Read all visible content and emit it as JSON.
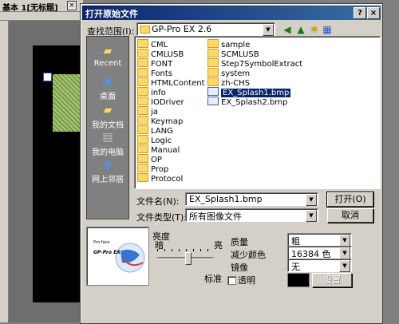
{
  "background_window": {
    "tab_title": "基本 1[无标题]",
    "tab_close": "×"
  },
  "dialog": {
    "title": "打开原始文件",
    "help_btn": "?",
    "close_btn": "×",
    "lookin_label": "查找范围(I):",
    "lookin_value": "GP-Pro EX 2.6",
    "places": [
      {
        "label": "Recent",
        "icon": "recent-folder-icon"
      },
      {
        "label": "桌面",
        "icon": "desktop-icon"
      },
      {
        "label": "我的文档",
        "icon": "my-documents-icon"
      },
      {
        "label": "我的电脑",
        "icon": "my-computer-icon"
      },
      {
        "label": "网上邻居",
        "icon": "network-icon"
      }
    ],
    "files_col1": [
      "CML",
      "CMLUSB",
      "FONT",
      "Fonts",
      "HTMLContent",
      "info",
      "IODriver",
      "ja",
      "Keymap",
      "LANG",
      "Logic",
      "Manual",
      "OP",
      "Prop",
      "Protocol"
    ],
    "files_col2": [
      {
        "name": "sample",
        "type": "folder"
      },
      {
        "name": "SCMLUSB",
        "type": "folder"
      },
      {
        "name": "Step7SymbolExtract",
        "type": "folder"
      },
      {
        "name": "system",
        "type": "folder"
      },
      {
        "name": "zh-CHS",
        "type": "folder"
      },
      {
        "name": "EX_Splash1.bmp",
        "type": "bmp",
        "selected": true
      },
      {
        "name": "EX_Splash2.bmp",
        "type": "bmp"
      }
    ],
    "filename_label": "文件名(N):",
    "filename_value": "EX_Splash1.bmp",
    "filetype_label": "文件类型(T):",
    "filetype_value": "所有图像文件",
    "open_btn": "打开(O)",
    "cancel_btn": "取消",
    "brightness_label": "亮度",
    "dark_label": "暗",
    "bright_label": "亮",
    "brightness_level": 0.55,
    "standard_label": "标准",
    "transparent_label": "透明",
    "quality_label": "质量",
    "quality_value": "粗",
    "reduce_color_label": "减少颜色",
    "reduce_color_value": "16384 色",
    "mirror_label": "镜像",
    "mirror_value": "无",
    "settings_btn": "设置",
    "preview_text": "GP-Pro EX",
    "preview_small": "Pro-face"
  },
  "colors": {
    "titlebar": "#0a246a",
    "selection": "#0a246a",
    "face": "#d4d0c8"
  }
}
